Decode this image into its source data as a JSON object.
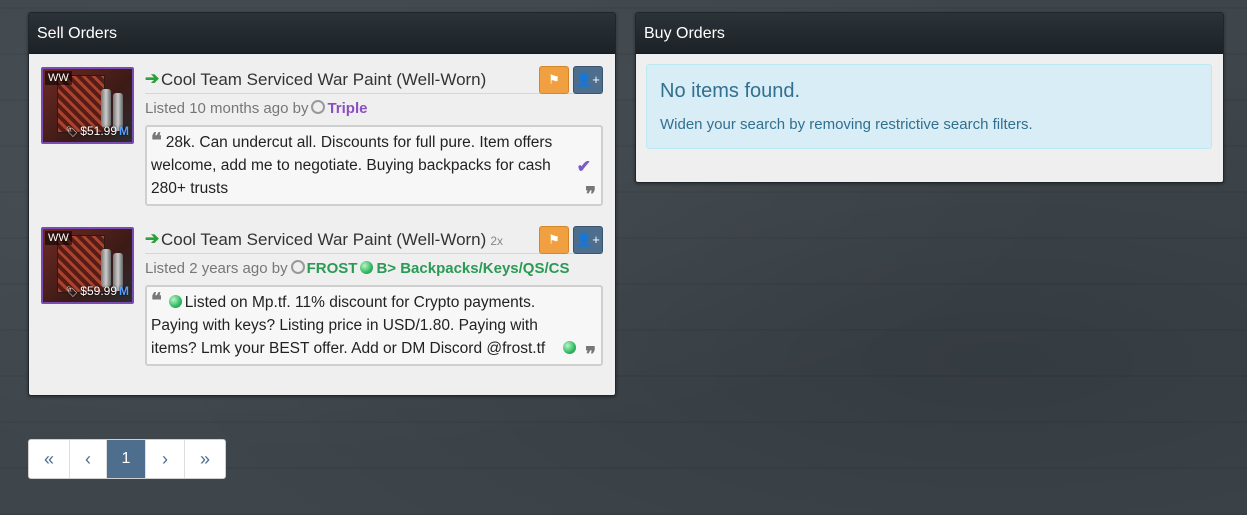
{
  "sell_orders": {
    "title": "Sell Orders",
    "listings": [
      {
        "item_name": "Cool Team Serviced War Paint (Well-Worn)",
        "quantity": "",
        "grade": "WW",
        "price": "$51.99",
        "price_suffix": "M",
        "listed_prefix": "Listed",
        "listed_time": "10 months ago",
        "by_label": "by",
        "user": "Triple",
        "user_extra": "",
        "note": "28k. Can undercut all. Discounts for full pure. Item offers welcome, add me to negotiate. Buying backpacks for cash 280+ trusts"
      },
      {
        "item_name": "Cool Team Serviced War Paint (Well-Worn)",
        "quantity": "2x",
        "grade": "WW",
        "price": "$59.99",
        "price_suffix": "M",
        "listed_prefix": "Listed",
        "listed_time": "2 years ago",
        "by_label": "by",
        "user": "FROST",
        "user_extra": "B> Backpacks/Keys/QS/CS",
        "note": "Listed on Mp.tf. 11% discount for Crypto payments. Paying with keys? Listing price in USD/1.80. Paying with items? Lmk your BEST offer. Add or DM Discord @frost.tf"
      }
    ]
  },
  "buy_orders": {
    "title": "Buy Orders",
    "empty_title": "No items found.",
    "empty_message": "Widen your search by removing restrictive search filters."
  },
  "pagination": {
    "first": "«",
    "prev": "‹",
    "current": "1",
    "next": "›",
    "last": "»"
  },
  "icons": {
    "arrow": "green-right-arrow-icon",
    "flag": "flag-icon",
    "add_user": "add-user-icon",
    "quote": "quote-icon",
    "check": "check-icon",
    "gem": "green-gem-icon",
    "tag": "price-tag-icon"
  },
  "colors": {
    "accent": "#4e6e8e",
    "flag_button": "#f0a040",
    "user_purple": "#8a50c0",
    "user_green": "#2a9a55",
    "info_bg": "#d9edf7"
  }
}
